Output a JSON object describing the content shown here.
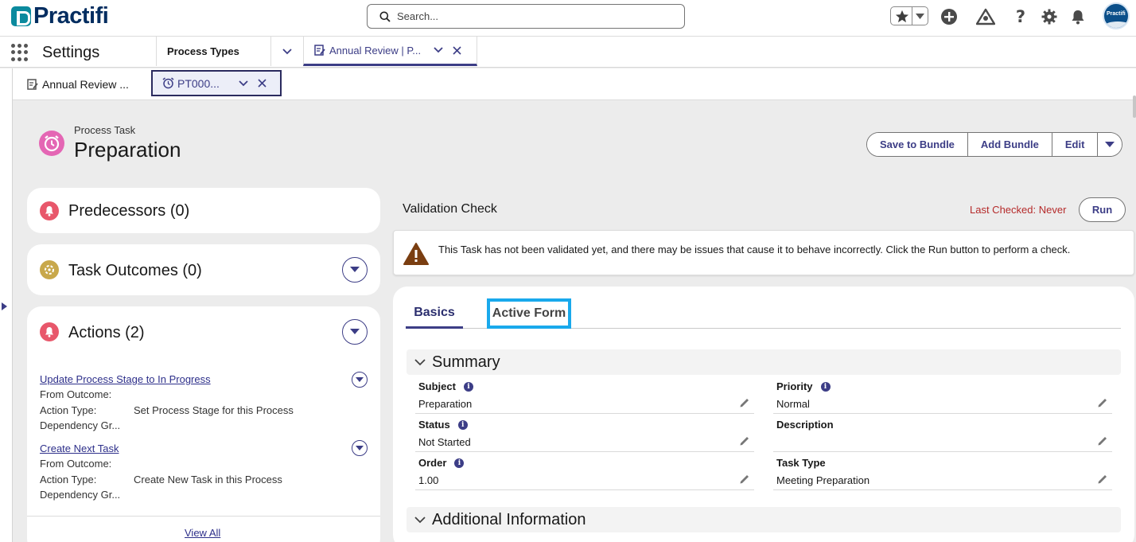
{
  "header": {
    "logo": "Practifi",
    "search_placeholder": "Search...",
    "avatar_text": "Practifi",
    "icons": [
      "star-icon",
      "chevron-down-icon",
      "add-icon",
      "trailhead-icon",
      "help-icon",
      "gear-icon",
      "bell-icon"
    ]
  },
  "nav": {
    "app_name": "Settings",
    "tabs": [
      {
        "label": "Process Types"
      },
      {
        "label": "Annual Review | P..."
      }
    ]
  },
  "subtabs": [
    {
      "label": "Annual Review ..."
    },
    {
      "label": "PT000..."
    }
  ],
  "page": {
    "object_label": "Process Task",
    "title": "Preparation",
    "actions": [
      "Save to Bundle",
      "Add Bundle",
      "Edit"
    ]
  },
  "left": {
    "predecessors": "Predecessors (0)",
    "outcomes": "Task Outcomes (0)",
    "actions_title": "Actions (2)",
    "actions": [
      {
        "link": "Update Process Stage to In Progress",
        "from_outcome_label": "From Outcome:",
        "from_outcome_value": "",
        "action_type_label": "Action Type:",
        "action_type_value": "Set Process Stage for this Process",
        "dependency_label": "Dependency Gr..."
      },
      {
        "link": "Create Next Task",
        "from_outcome_label": "From Outcome:",
        "from_outcome_value": "",
        "action_type_label": "Action Type:",
        "action_type_value": "Create New Task in this Process",
        "dependency_label": "Dependency Gr..."
      }
    ],
    "view_all": "View All"
  },
  "validation": {
    "title": "Validation Check",
    "last_checked": "Last Checked: Never",
    "run_label": "Run",
    "message": "This Task has not been validated yet, and there may be issues that cause it to behave incorrectly. Click the Run button to perform a check."
  },
  "detail": {
    "tabs": [
      "Basics",
      "Active Form"
    ],
    "active_tab": "Basics",
    "summary_title": "Summary",
    "fields": {
      "subject": {
        "label": "Subject",
        "value": "Preparation"
      },
      "priority": {
        "label": "Priority",
        "value": "Normal"
      },
      "status": {
        "label": "Status",
        "value": "Not Started"
      },
      "description": {
        "label": "Description",
        "value": ""
      },
      "order": {
        "label": "Order",
        "value": "1.00"
      },
      "task_type": {
        "label": "Task Type",
        "value": "Meeting Preparation"
      }
    },
    "additional_title": "Additional Information"
  },
  "colors": {
    "brand": "#032d60",
    "accent": "#3c3d86",
    "focus_outline": "#19a9ec",
    "warning_text": "#b52a2a",
    "task_icon": "#e466b4"
  }
}
